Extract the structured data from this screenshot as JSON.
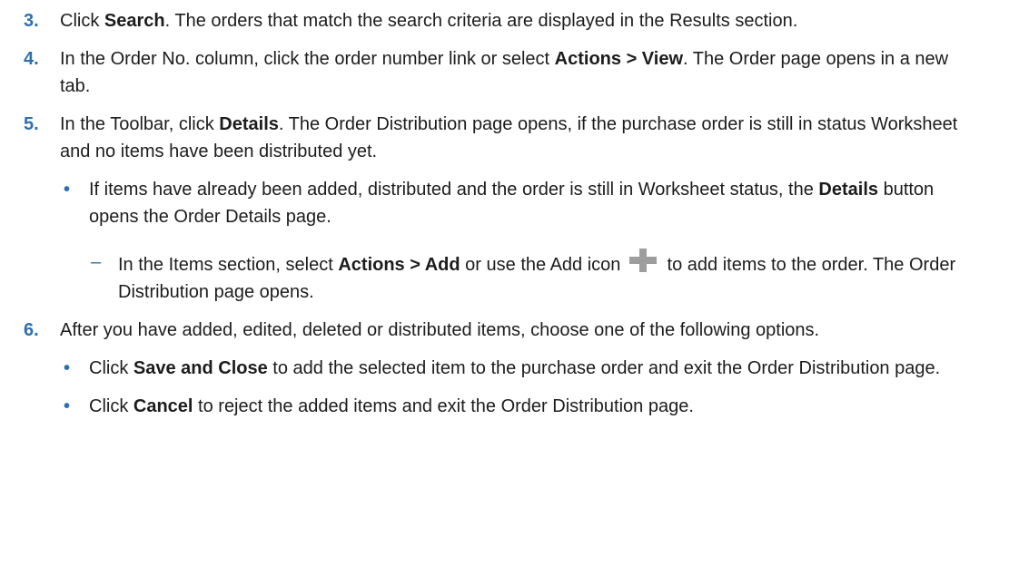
{
  "steps": [
    {
      "num": "3.",
      "parts": [
        {
          "t": "Click "
        },
        {
          "b": "Search"
        },
        {
          "t": ". The orders that match the search criteria are displayed in the Results section."
        }
      ]
    },
    {
      "num": "4.",
      "parts": [
        {
          "t": "In the Order No. column, click the order number link or select "
        },
        {
          "b": "Actions > View"
        },
        {
          "t": ". The Order page opens in a new tab."
        }
      ]
    },
    {
      "num": "5.",
      "parts": [
        {
          "t": "In the Toolbar, click "
        },
        {
          "b": "Details"
        },
        {
          "t": ". The Order Distribution page opens, if the purchase order is still in status Worksheet and no items have been distributed yet."
        }
      ],
      "bullets": [
        {
          "marker": "•",
          "parts": [
            {
              "t": "If items have already been added, distributed and the order is still in Worksheet status, the "
            },
            {
              "b": "Details"
            },
            {
              "t": " button opens the Order Details page."
            }
          ],
          "sub": [
            {
              "marker": "–",
              "parts": [
                {
                  "t": "In the Items section, select "
                },
                {
                  "b": "Actions > Add"
                },
                {
                  "t": " or use the Add icon "
                },
                {
                  "icon": "add-icon"
                },
                {
                  "t": " to add items to the order. The Order Distribution page opens."
                }
              ]
            }
          ]
        }
      ]
    },
    {
      "num": "6.",
      "parts": [
        {
          "t": "After you have added, edited, deleted or distributed items, choose one of the following options."
        }
      ],
      "bullets": [
        {
          "marker": "•",
          "parts": [
            {
              "t": "Click "
            },
            {
              "b": "Save and Close"
            },
            {
              "t": " to add the selected item to the purchase order and exit the Order Distribution page."
            }
          ]
        },
        {
          "marker": "•",
          "parts": [
            {
              "t": "Click "
            },
            {
              "b": "Cancel"
            },
            {
              "t": " to reject the added items and exit the Order Distribution page."
            }
          ]
        }
      ]
    }
  ]
}
